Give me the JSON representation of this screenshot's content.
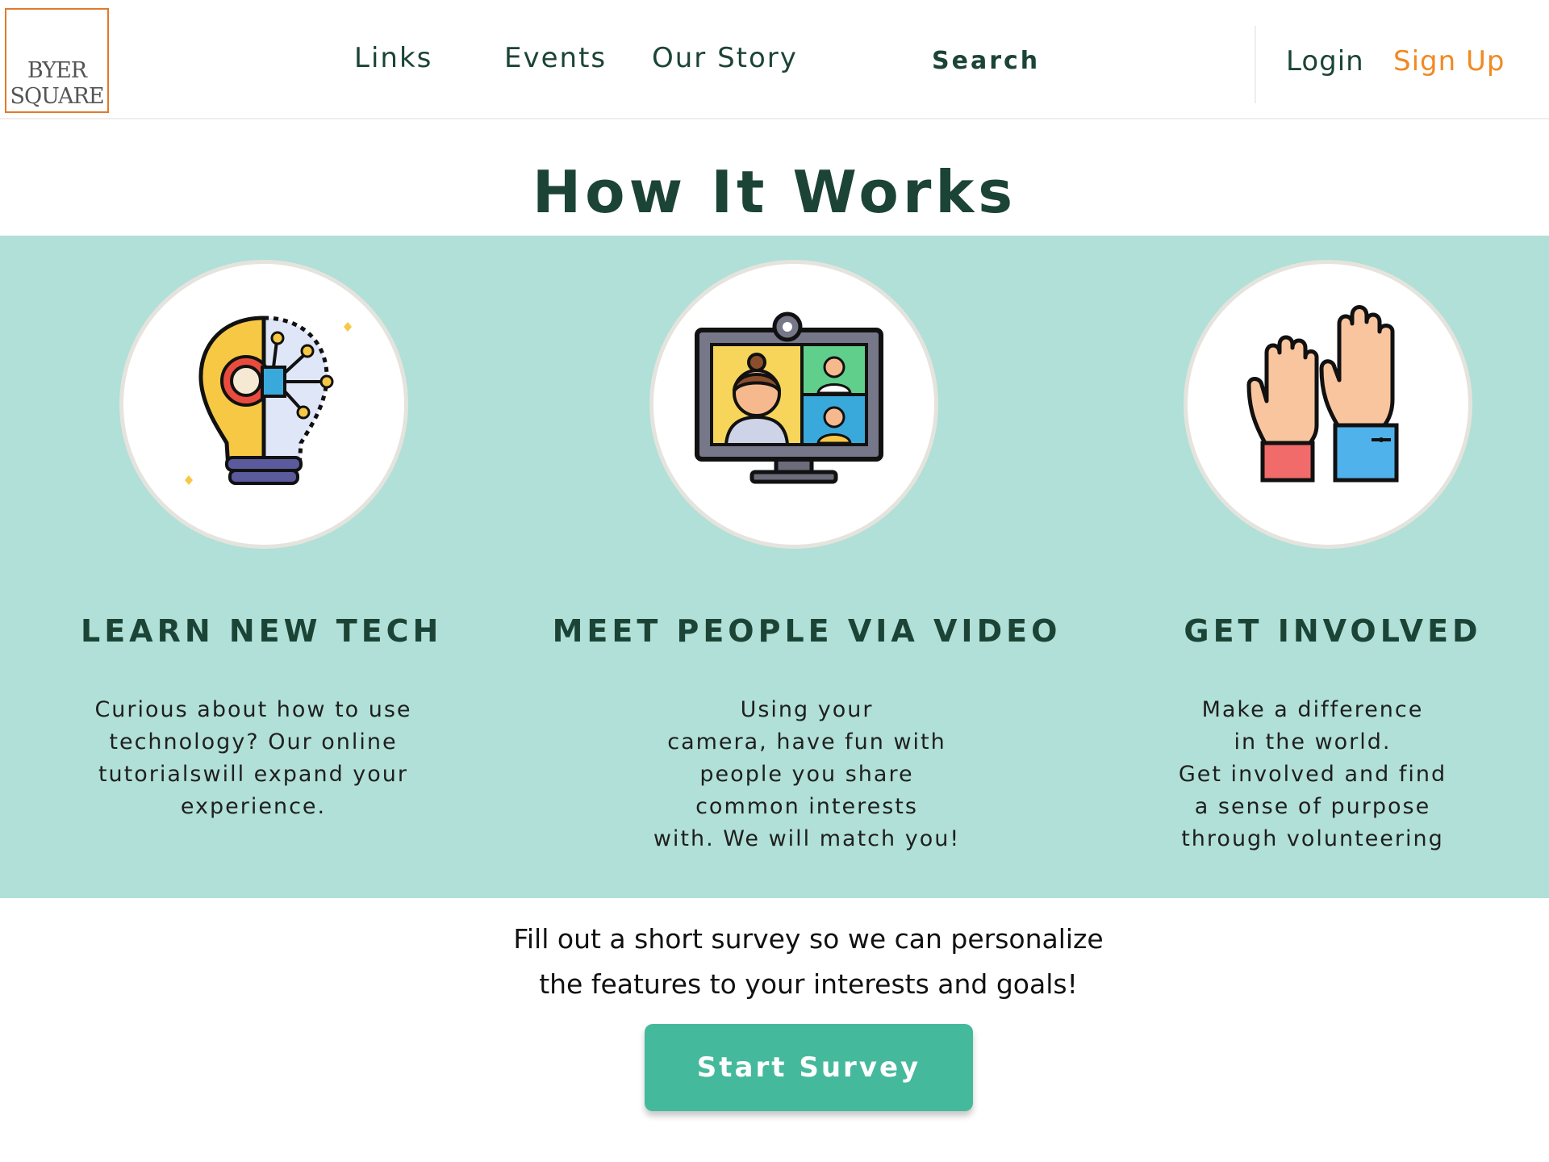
{
  "logo": {
    "line1": "BYER",
    "line2": "SQUARE"
  },
  "nav": {
    "links": "Links",
    "events": "Events",
    "our_story": "Our Story",
    "search": "Search",
    "login": "Login",
    "signup": "Sign Up"
  },
  "main": {
    "title": "How It Works",
    "features": [
      {
        "title": "LEARN NEW TECH",
        "icon": "lightbulb-gear-icon",
        "text": "Curious about how to use\ntechnology? Our online\ntutorialswill expand your\nexperience."
      },
      {
        "title": "MEET PEOPLE VIA VIDEO",
        "icon": "video-call-monitor-icon",
        "text": "Using your\ncamera, have fun with\npeople you share\ncommon interests\nwith. We will match you!"
      },
      {
        "title": "GET INVOLVED",
        "icon": "raised-hands-icon",
        "text": "Make a difference\nin the world.\nGet involved and find\na sense of purpose\nthrough volunteering"
      }
    ]
  },
  "survey": {
    "text": "Fill out a short survey so we can personalize\nthe features to your interests and goals!",
    "button": "Start Survey"
  },
  "colors": {
    "brand_dark_green": "#1c4436",
    "accent_orange": "#f08a24",
    "band_teal": "#b0e0d7",
    "button_green": "#45b99b"
  }
}
